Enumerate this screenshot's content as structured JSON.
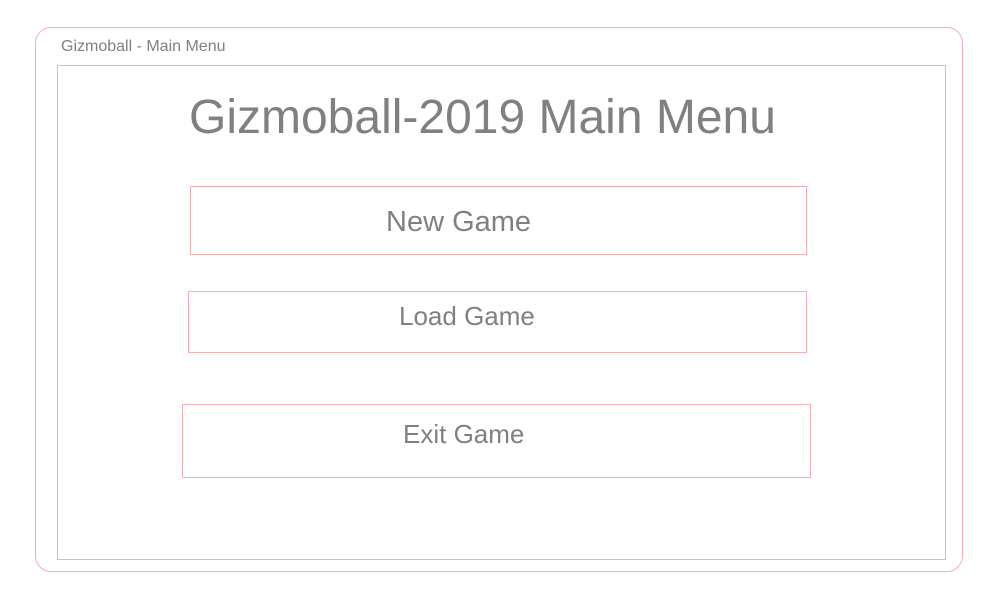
{
  "window": {
    "title": "Gizmoball - Main Menu"
  },
  "main": {
    "heading": "Gizmoball-2019 Main Menu"
  },
  "menu": {
    "new_game_label": "New Game",
    "load_game_label": "Load Game",
    "exit_game_label": "Exit Game"
  },
  "colors": {
    "border": "#f4aeb6",
    "text": "#808080",
    "background": "#ffffff"
  }
}
